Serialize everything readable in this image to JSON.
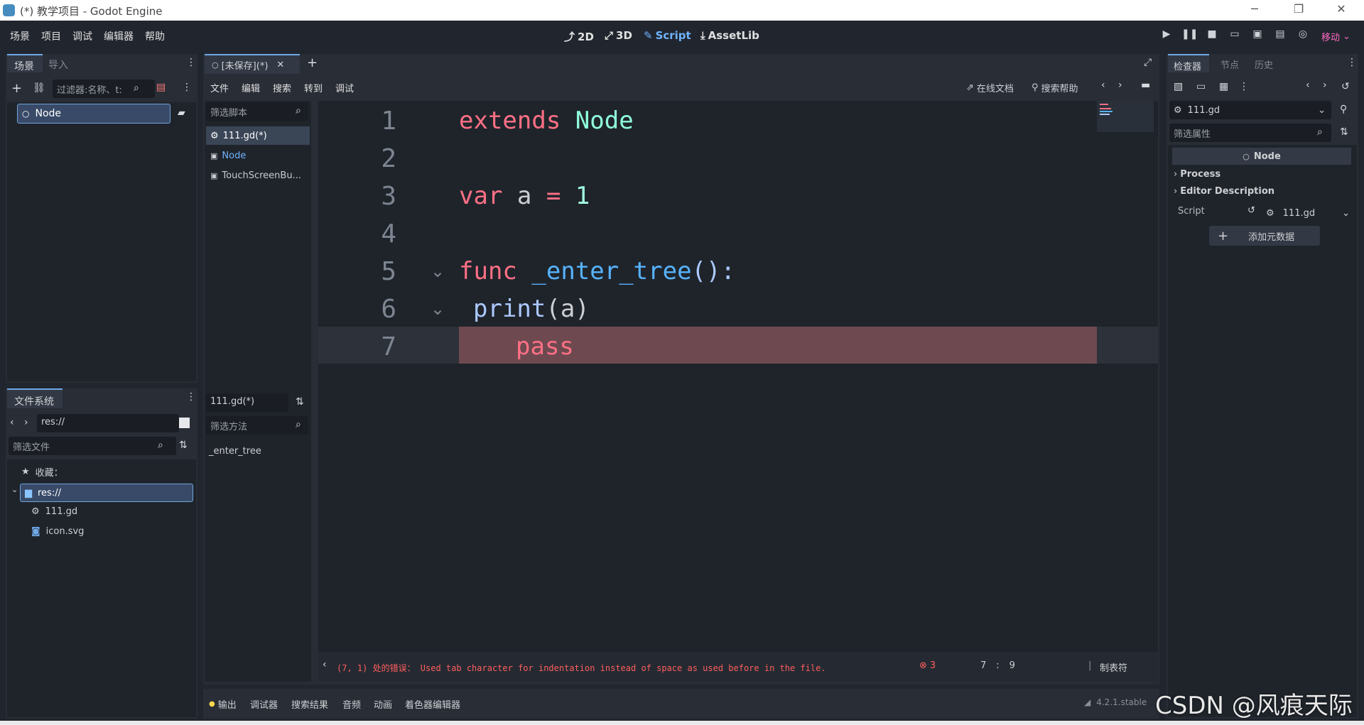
{
  "window": {
    "title": "(*) 教学项目 - Godot Engine",
    "controls": [
      "─",
      "❐",
      "✕"
    ]
  },
  "menubar": {
    "items": [
      "场景",
      "项目",
      "调试",
      "编辑器",
      "帮助"
    ],
    "main_screens": [
      "2D",
      "3D",
      "Script",
      "AssetLib"
    ],
    "renderer": "移动"
  },
  "scene_dock": {
    "tabs": [
      "场景",
      "导入"
    ],
    "filter_placeholder": "过滤器:名称、t:",
    "root_node": "Node"
  },
  "filesystem_dock": {
    "tab": "文件系统",
    "path": "res://",
    "filter_placeholder": "筛选文件",
    "favorites": "收藏：",
    "root": "res://",
    "files": [
      "111.gd",
      "icon.svg"
    ]
  },
  "script_editor": {
    "tab_label": "[未保存](*)",
    "menu": [
      "文件",
      "编辑",
      "搜索",
      "转到",
      "调试"
    ],
    "online_docs": "在线文档",
    "search_help": "搜索帮助",
    "script_filter_placeholder": "筛选脚本",
    "scripts": [
      "111.gd(*)",
      "Node",
      "TouchScreenBu..."
    ],
    "current_script": "111.gd(*)",
    "method_filter_placeholder": "筛选方法",
    "methods": [
      "_enter_tree"
    ],
    "line_numbers": [
      "1",
      "2",
      "3",
      "4",
      "5",
      "6",
      "7"
    ],
    "code": {
      "l1_kw": "extends",
      "l1_type": "Node",
      "l3_kw": "var",
      "l3_id": "a",
      "l3_eq": "=",
      "l3_num": "1",
      "l5_kw": "func",
      "l5_fn": "_enter_tree",
      "l5_rest": "():",
      "l6_fn": "print",
      "l6_rest": "(a)",
      "l7_kw": "pass"
    },
    "error_line": 7
  },
  "status": {
    "error_text": "(7, 1) 处的错误： Used tab character for indentation instead of space as used before in the file.",
    "error_count": "3",
    "line": "7",
    "col": "9",
    "indent": "制表符"
  },
  "bottom_panel": {
    "tabs": [
      "输出",
      "调试器",
      "搜索结果",
      "音频",
      "动画",
      "着色器编辑器"
    ],
    "version": "4.2.1.stable"
  },
  "inspector": {
    "tabs": [
      "检查器",
      "节点",
      "历史"
    ],
    "resource": "111.gd",
    "filter_placeholder": "筛选属性",
    "node_header": "Node",
    "sections": [
      "Process",
      "Editor Description"
    ],
    "script_label": "Script",
    "script_value": "111.gd",
    "add_metadata": "添加元数据"
  },
  "watermark": "CSDN @风痕天际",
  "colors": {
    "accent": "#6fb3ff",
    "error": "#ff5d5d",
    "error_line_bg": "#6e4a50",
    "keyword": "#ff7085"
  }
}
